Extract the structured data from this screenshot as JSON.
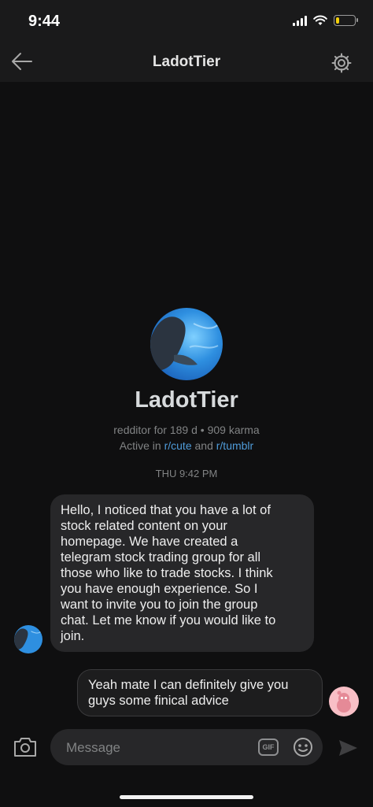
{
  "status_bar": {
    "time": "9:44",
    "battery_level": 0.2,
    "battery_color": "#f5d00a"
  },
  "header": {
    "title": "LadotTier",
    "back_icon": "arrow-left-icon",
    "settings_icon": "gear-icon"
  },
  "profile": {
    "name": "LadotTier",
    "meta": "redditor for 189 d • 909 karma",
    "active_prefix": "Active in ",
    "sub1": "r/cute",
    "active_join": " and ",
    "sub2": "r/tumblr"
  },
  "conversation": {
    "timestamp": "THU 9:42 PM",
    "incoming": {
      "lines": [
        "Hello, I noticed that you have a lot of",
        "stock related content on your",
        "homepage. We have created a",
        "telegram stock trading group for all",
        "those who like to trade stocks. I think",
        "you have enough experience. So I",
        "want to invite you to join the group",
        "chat. Let me know if you would like to",
        "join."
      ]
    },
    "outgoing": {
      "lines": [
        "Yeah mate I can definitely give you",
        "guys some finical advice"
      ]
    }
  },
  "composer": {
    "placeholder": "Message",
    "gif_label": "GIF"
  },
  "colors": {
    "link": "#4f9bd9",
    "background": "#0f0f10",
    "bar": "#1a1a1b",
    "bubble": "#272729"
  }
}
